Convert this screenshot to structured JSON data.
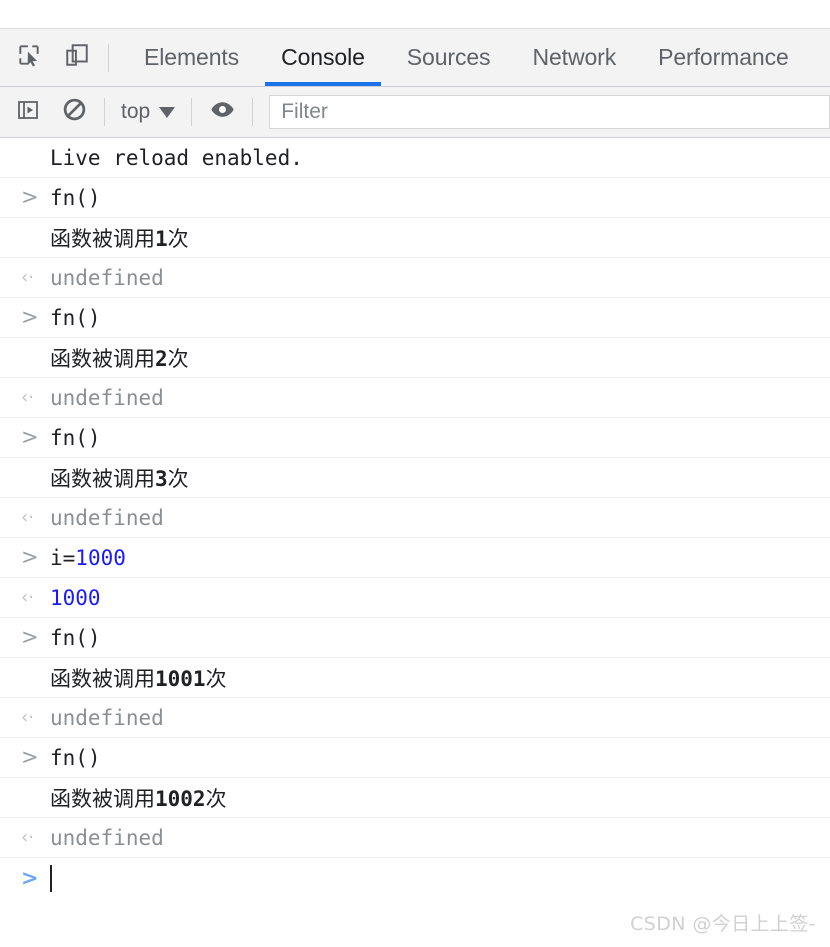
{
  "window": {
    "title": "Chrome DevTools - Console"
  },
  "tabbar": {
    "inspect_icon": "inspect-cursor-icon",
    "device_icon": "device-toolbar-icon",
    "tabs": [
      {
        "label": "Elements",
        "active": false
      },
      {
        "label": "Console",
        "active": true
      },
      {
        "label": "Sources",
        "active": false
      },
      {
        "label": "Network",
        "active": false
      },
      {
        "label": "Performance",
        "active": false
      }
    ],
    "active_tab_color": "#1a73e8"
  },
  "console_toolbar": {
    "sidebar_icon": "show-console-sidebar-icon",
    "clear_icon": "clear-console-icon",
    "context": "top",
    "context_caret": "chevron-down-icon",
    "eye_icon": "live-expression-eye-icon",
    "filter": {
      "value": "",
      "placeholder": "Filter"
    }
  },
  "console": {
    "prompt_in": ">",
    "prompt_out": "‹·",
    "cursor": "text-cursor",
    "rows": [
      {
        "kind": "log",
        "gutter": "",
        "text": "Live reload enabled.",
        "style": "mono-black"
      },
      {
        "kind": "input",
        "gutter": ">",
        "text": "fn()",
        "style": "mono-black"
      },
      {
        "kind": "log",
        "gutter": "",
        "prefix": "函数被调用",
        "number": "1",
        "suffix": "次",
        "style": "cjk"
      },
      {
        "kind": "output",
        "gutter": "‹·",
        "text": "undefined",
        "style": "mono-gray"
      },
      {
        "kind": "input",
        "gutter": ">",
        "text": "fn()",
        "style": "mono-black"
      },
      {
        "kind": "log",
        "gutter": "",
        "prefix": "函数被调用",
        "number": "2",
        "suffix": "次",
        "style": "cjk"
      },
      {
        "kind": "output",
        "gutter": "‹·",
        "text": "undefined",
        "style": "mono-gray"
      },
      {
        "kind": "input",
        "gutter": ">",
        "text": "fn()",
        "style": "mono-black"
      },
      {
        "kind": "log",
        "gutter": "",
        "prefix": "函数被调用",
        "number": "3",
        "suffix": "次",
        "style": "cjk"
      },
      {
        "kind": "output",
        "gutter": "‹·",
        "text": "undefined",
        "style": "mono-gray"
      },
      {
        "kind": "input",
        "gutter": ">",
        "expr_name": "i=",
        "expr_value": "1000",
        "style": "mono-expr"
      },
      {
        "kind": "output",
        "gutter": "‹·",
        "text": "1000",
        "style": "mono-blue"
      },
      {
        "kind": "input",
        "gutter": ">",
        "text": "fn()",
        "style": "mono-black"
      },
      {
        "kind": "log",
        "gutter": "",
        "prefix": "函数被调用",
        "number": "1001",
        "suffix": "次",
        "style": "cjk"
      },
      {
        "kind": "output",
        "gutter": "‹·",
        "text": "undefined",
        "style": "mono-gray"
      },
      {
        "kind": "input",
        "gutter": ">",
        "text": "fn()",
        "style": "mono-black"
      },
      {
        "kind": "log",
        "gutter": "",
        "prefix": "函数被调用",
        "number": "1002",
        "suffix": "次",
        "style": "cjk"
      },
      {
        "kind": "output",
        "gutter": "‹·",
        "text": "undefined",
        "style": "mono-gray"
      },
      {
        "kind": "prompt",
        "gutter": ">",
        "text": "",
        "style": "mono-black"
      }
    ]
  },
  "watermark": {
    "text": "CSDN @今日上上签-"
  },
  "colors": {
    "accent_blue": "#1a73e8",
    "number_blue": "#1a1aff",
    "text_dark": "#202124",
    "text_gray": "#8a8f94",
    "toolbar_bg": "#f3f3f3"
  }
}
